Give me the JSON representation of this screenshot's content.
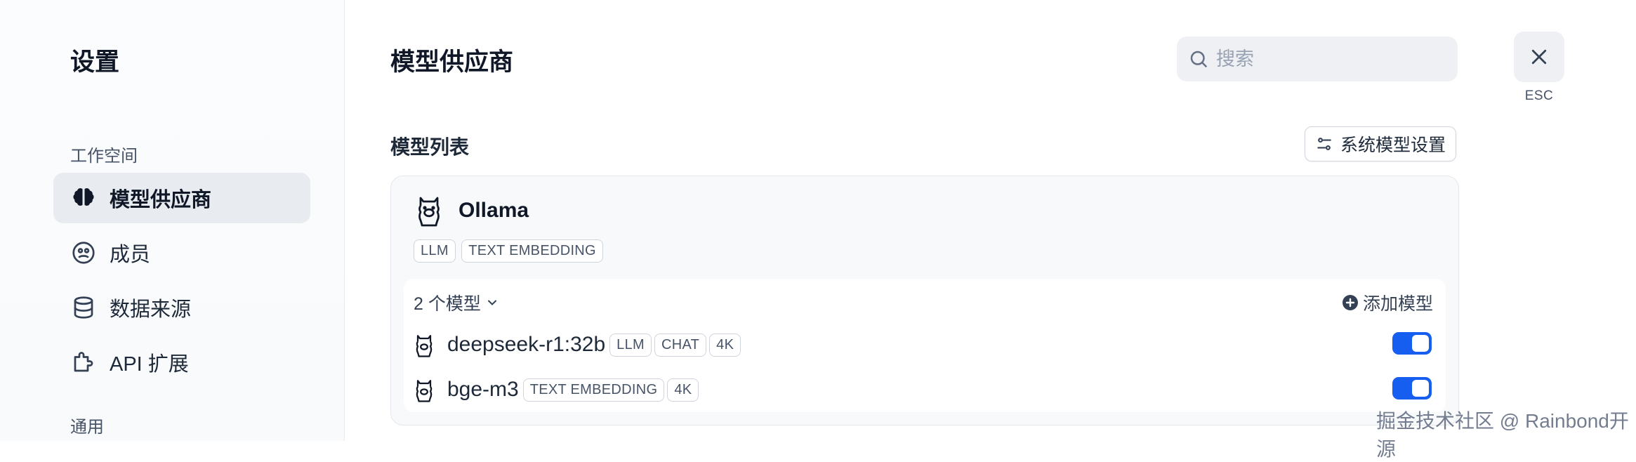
{
  "sidebar": {
    "title": "设置",
    "sections": [
      {
        "label": "工作空间"
      },
      {
        "label": "通用"
      }
    ],
    "items": [
      {
        "label": "模型供应商",
        "icon": "brain-icon",
        "active": true
      },
      {
        "label": "成员",
        "icon": "members-icon",
        "active": false
      },
      {
        "label": "数据来源",
        "icon": "database-icon",
        "active": false
      },
      {
        "label": "API 扩展",
        "icon": "puzzle-icon",
        "active": false
      }
    ]
  },
  "header": {
    "title": "模型供应商",
    "search_placeholder": "搜索",
    "esc_label": "ESC"
  },
  "model_list": {
    "title": "模型列表",
    "system_settings_label": "系统模型设置",
    "provider": {
      "name": "Ollama",
      "tags": [
        "LLM",
        "TEXT EMBEDDING"
      ],
      "model_count_label": "2 个模型",
      "add_model_label": "添加模型",
      "models": [
        {
          "name": "deepseek-r1:32b",
          "tags": [
            "LLM",
            "CHAT",
            "4K"
          ],
          "enabled": true
        },
        {
          "name": "bge-m3",
          "tags": [
            "TEXT EMBEDDING",
            "4K"
          ],
          "enabled": true
        }
      ]
    }
  },
  "watermark": "掘金技术社区 @ Rainbond开源",
  "colors": {
    "accent": "#155eef",
    "active_bg": "#e8ebf0"
  }
}
